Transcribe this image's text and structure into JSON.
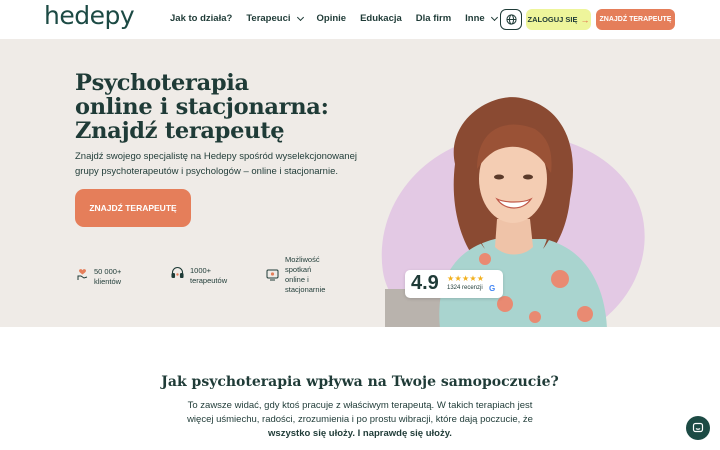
{
  "header": {
    "logo": "hedepy",
    "nav": [
      {
        "label": "Jak to działa?",
        "dropdown": false
      },
      {
        "label": "Terapeuci",
        "dropdown": true
      },
      {
        "label": "Opinie",
        "dropdown": false
      },
      {
        "label": "Edukacja",
        "dropdown": false
      },
      {
        "label": "Dla firm",
        "dropdown": false
      },
      {
        "label": "Inne",
        "dropdown": true
      }
    ],
    "lang_icon": "globe-icon",
    "login_label": "ZALOGUJ SIĘ",
    "login_arrow": "→",
    "find_label": "ZNAJDŹ TERAPEUTĘ"
  },
  "hero": {
    "title_lines": [
      "Psychoterapia",
      "online i stacjonarna:",
      "Znajdź terapeutę"
    ],
    "subtitle": "Znajdź swojego specjalistę na Hedepy spośród wyselekcjonowanej grupy psychoterapeutów i psychologów – online i stacjonarnie.",
    "cta_label": "ZNAJDŹ TERAPEUTĘ",
    "stats": [
      {
        "icon": "hand-heart-icon",
        "lines": [
          "50 000+",
          "klientów"
        ]
      },
      {
        "icon": "headphones-icon",
        "lines": [
          "1000+",
          "terapeutów"
        ]
      },
      {
        "icon": "video-call-icon",
        "lines": [
          "Możliwość",
          "spotkań",
          "online i",
          "stacjonarnie"
        ]
      }
    ],
    "rating": {
      "value": "4.9",
      "stars": "★★★★★",
      "reviews": "1324 recenzji",
      "source_icon": "google-icon"
    }
  },
  "section": {
    "title": "Jak psychoterapia wpływa na Twoje samopoczucie?",
    "text_plain": "To zawsze widać, gdy ktoś pracuje z właściwym terapeutą. W takich terapiach jest więcej uśmiechu, radości, zrozumienia i po prostu wibracji, które dają poczucie, że",
    "text_bold": "wszystko się ułoży. I naprawdę się ułoży."
  },
  "chat_icon": "chat-icon",
  "colors": {
    "primary": "#1c4a44",
    "accent": "#e57e5a",
    "login_bg": "#eef59b",
    "hero_bg": "#efebe7",
    "blob": "#e3c9e4",
    "star": "#f2b01e"
  }
}
